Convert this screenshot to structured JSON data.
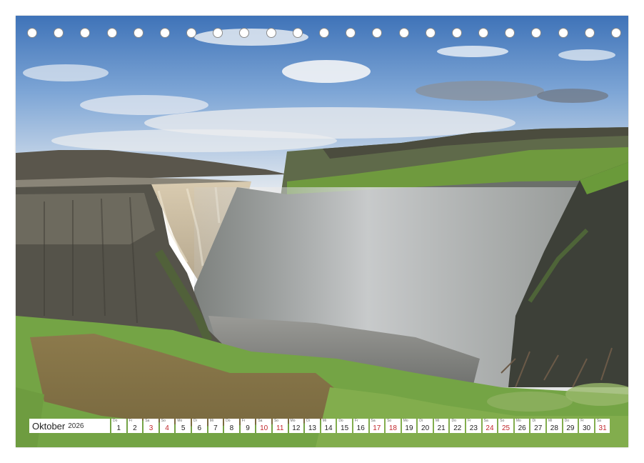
{
  "calendar": {
    "month": "Oktober",
    "year": "2026",
    "days": [
      {
        "d": "1",
        "wd": "Do",
        "sun": false
      },
      {
        "d": "2",
        "wd": "Fr",
        "sun": false
      },
      {
        "d": "3",
        "wd": "Sa",
        "sun": true
      },
      {
        "d": "4",
        "wd": "So",
        "sun": true
      },
      {
        "d": "5",
        "wd": "Mo",
        "sun": false
      },
      {
        "d": "6",
        "wd": "Di",
        "sun": false
      },
      {
        "d": "7",
        "wd": "Mi",
        "sun": false
      },
      {
        "d": "8",
        "wd": "Do",
        "sun": false
      },
      {
        "d": "9",
        "wd": "Fr",
        "sun": false
      },
      {
        "d": "10",
        "wd": "Sa",
        "sun": true
      },
      {
        "d": "11",
        "wd": "So",
        "sun": true
      },
      {
        "d": "12",
        "wd": "Mo",
        "sun": false
      },
      {
        "d": "13",
        "wd": "Di",
        "sun": false
      },
      {
        "d": "14",
        "wd": "Mi",
        "sun": false
      },
      {
        "d": "15",
        "wd": "Do",
        "sun": false
      },
      {
        "d": "16",
        "wd": "Fr",
        "sun": false
      },
      {
        "d": "17",
        "wd": "Sa",
        "sun": true
      },
      {
        "d": "18",
        "wd": "So",
        "sun": true
      },
      {
        "d": "19",
        "wd": "Mo",
        "sun": false
      },
      {
        "d": "20",
        "wd": "Di",
        "sun": false
      },
      {
        "d": "21",
        "wd": "Mi",
        "sun": false
      },
      {
        "d": "22",
        "wd": "Do",
        "sun": false
      },
      {
        "d": "23",
        "wd": "Fr",
        "sun": false
      },
      {
        "d": "24",
        "wd": "Sa",
        "sun": true
      },
      {
        "d": "25",
        "wd": "So",
        "sun": true
      },
      {
        "d": "26",
        "wd": "Mo",
        "sun": false
      },
      {
        "d": "27",
        "wd": "Di",
        "sun": false
      },
      {
        "d": "28",
        "wd": "Mi",
        "sun": false
      },
      {
        "d": "29",
        "wd": "Do",
        "sun": false
      },
      {
        "d": "30",
        "wd": "Fr",
        "sun": false
      },
      {
        "d": "31",
        "wd": "Sa",
        "sun": true
      }
    ]
  },
  "binding": {
    "hole_count": 23
  },
  "photo": {
    "subject": "waterfall-canyon",
    "sky": "#5a8cc8",
    "grass": "#7aa84a",
    "rock": "#4a4a42"
  }
}
